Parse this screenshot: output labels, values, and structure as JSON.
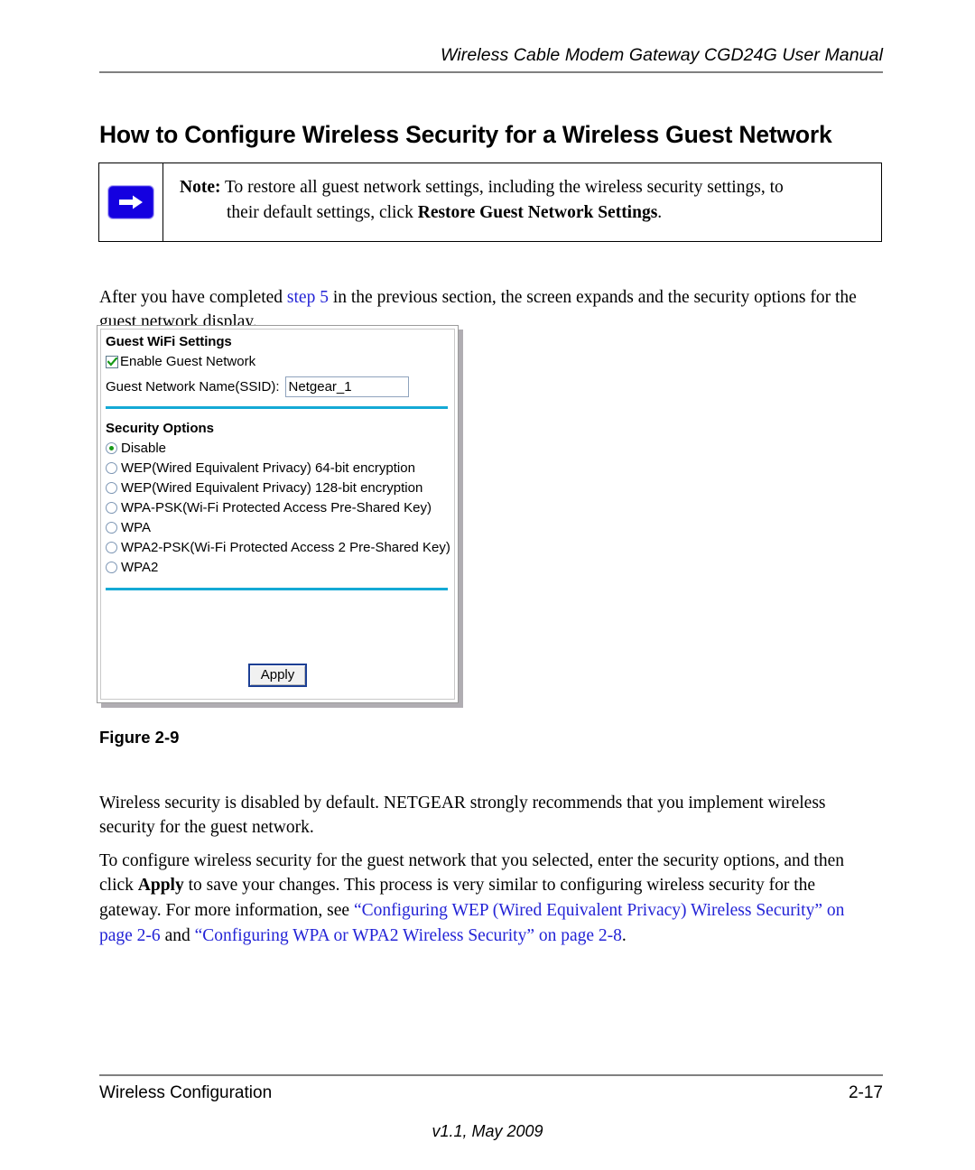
{
  "header": {
    "running_title": "Wireless Cable Modem Gateway CGD24G User Manual"
  },
  "page_title": "How to Configure Wireless Security for a Wireless Guest Network",
  "note": {
    "icon": "blue-right-arrow-icon",
    "label": "Note:",
    "line1": " To restore all guest network settings, including the wireless security settings, to",
    "line2_prefix": "their default settings, click ",
    "line2_bold": "Restore Guest Network Settings",
    "line2_suffix": "."
  },
  "intro_paragraph": {
    "before_link": "After you have completed ",
    "link": "step 5",
    "after_link": " in the previous section, the screen expands and the security options for the guest network display."
  },
  "figure": {
    "caption": "Figure 2-9",
    "screenshot": {
      "section_title": "Guest WiFi Settings",
      "enable_checkbox": {
        "label": "Enable Guest Network",
        "checked": true
      },
      "ssid_field": {
        "label": "Guest Network Name(SSID):",
        "value": "Netgear_1"
      },
      "security_title": "Security Options",
      "security_options": [
        {
          "label": "Disable",
          "selected": true
        },
        {
          "label": "WEP(Wired Equivalent Privacy) 64-bit encryption",
          "selected": false
        },
        {
          "label": "WEP(Wired Equivalent Privacy) 128-bit encryption",
          "selected": false
        },
        {
          "label": "WPA-PSK(Wi-Fi Protected Access Pre-Shared Key)",
          "selected": false
        },
        {
          "label": "WPA",
          "selected": false
        },
        {
          "label": "WPA2-PSK(Wi-Fi Protected Access 2 Pre-Shared Key)",
          "selected": false
        },
        {
          "label": "WPA2",
          "selected": false
        }
      ],
      "apply_button": "Apply",
      "accent_color": "#14a9d5",
      "check_color": "#179a18",
      "radio_selected_color": "#179a18",
      "button_border_color": "#1c3f94"
    }
  },
  "default_paragraph": "Wireless security is disabled by default. NETGEAR strongly recommends that you implement wireless security for the guest network.",
  "config_paragraph": {
    "part1": "To configure wireless security for the guest network that you selected, enter the security options, and then click ",
    "bold1": "Apply",
    "part2": " to save your changes. This process is very similar to configuring wireless security for the gateway. For more information, see ",
    "link1": "“Configuring WEP (Wired Equivalent Privacy) Wireless Security” on page 2-6",
    "part3": " and ",
    "link2": "“Configuring WPA or WPA2 Wireless Security” on page 2-8",
    "part4": "."
  },
  "footer": {
    "section": "Wireless Configuration",
    "page_number": "2-17",
    "version": "v1.1, May 2009"
  },
  "colors": {
    "link": "#2323d6",
    "rule": "#808080"
  }
}
